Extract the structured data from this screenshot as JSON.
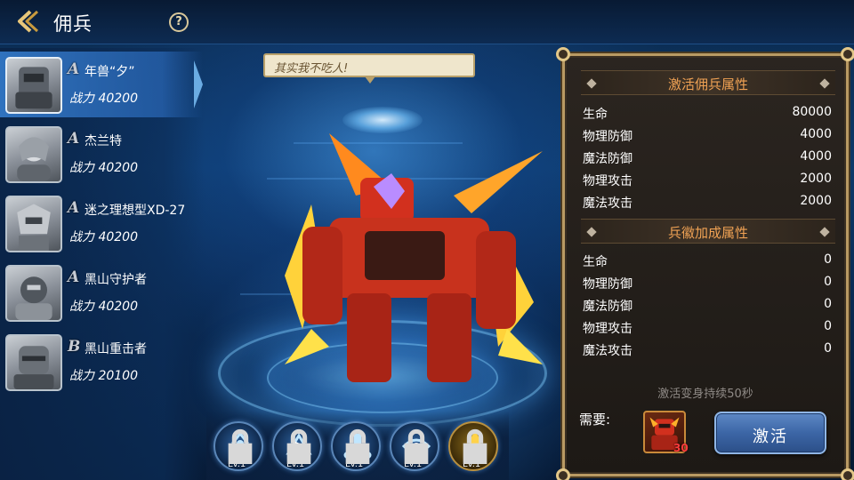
{
  "header": {
    "title": "佣兵",
    "help_label": "?"
  },
  "mercenaries": [
    {
      "grade": "A",
      "name": "年兽“夕”",
      "power": "战力 40200",
      "selected": true
    },
    {
      "grade": "A",
      "name": "杰兰特",
      "power": "战力 40200",
      "selected": false
    },
    {
      "grade": "A",
      "name": "迷之理想型XD-27",
      "power": "战力 40200",
      "selected": false
    },
    {
      "grade": "A",
      "name": "黑山守护者",
      "power": "战力 40200",
      "selected": false
    },
    {
      "grade": "B",
      "name": "黑山重击者",
      "power": "战力 20100",
      "selected": false
    }
  ],
  "speech": "其实我不吃人!",
  "skills": [
    {
      "icon": "skill-icon-1",
      "level": "Lv.1",
      "locked": true
    },
    {
      "icon": "skill-icon-2",
      "level": "Lv.1",
      "locked": true
    },
    {
      "icon": "skill-icon-3",
      "level": "Lv.1",
      "locked": true
    },
    {
      "icon": "skill-icon-4",
      "level": "Lv.1",
      "locked": true
    },
    {
      "icon": "skill-icon-5",
      "level": "Lv.1",
      "locked": true
    }
  ],
  "panel": {
    "activate_attrs_title": "激活佣兵属性",
    "activate_attrs": [
      {
        "label": "生命",
        "value": "80000"
      },
      {
        "label": "物理防御",
        "value": "4000"
      },
      {
        "label": "魔法防御",
        "value": "4000"
      },
      {
        "label": "物理攻击",
        "value": "2000"
      },
      {
        "label": "魔法攻击",
        "value": "2000"
      }
    ],
    "badge_attrs_title": "兵徽加成属性",
    "badge_attrs": [
      {
        "label": "生命",
        "value": "0"
      },
      {
        "label": "物理防御",
        "value": "0"
      },
      {
        "label": "魔法防御",
        "value": "0"
      },
      {
        "label": "物理攻击",
        "value": "0"
      },
      {
        "label": "魔法攻击",
        "value": "0"
      }
    ],
    "transform_note": "激活变身持续50秒",
    "need_label": "需要:",
    "need_count": "30",
    "activate_label": "激活"
  },
  "colors": {
    "accent_orange": "#f0a254",
    "panel_border": "#b99a63",
    "button_blue": "#3c66a6",
    "need_count_red": "#ff3b3b"
  }
}
